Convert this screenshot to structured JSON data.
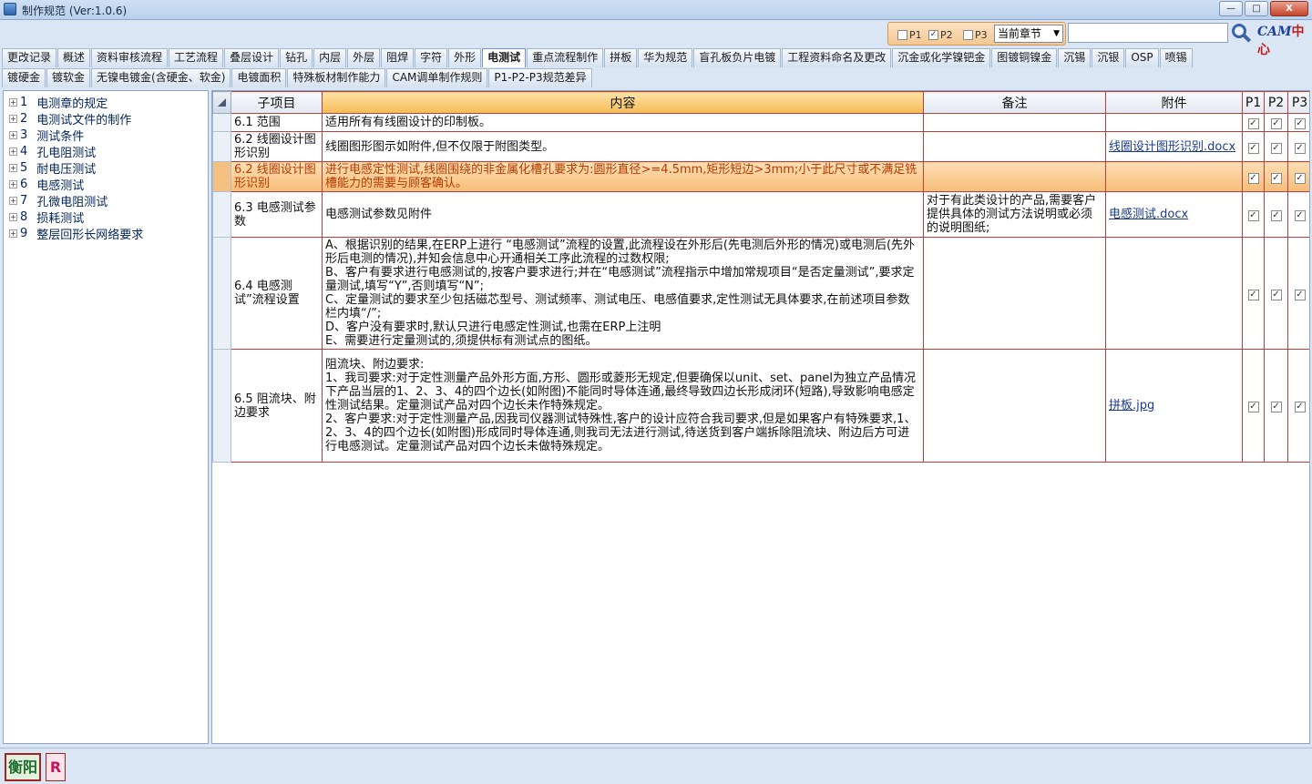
{
  "window": {
    "title": "制作规范 (Ver:1.0.6)",
    "min": "—",
    "max": "□",
    "close": "X"
  },
  "filters": {
    "p1": {
      "label": "P1",
      "checked": false
    },
    "p2": {
      "label": "P2",
      "checked": true
    },
    "p3": {
      "label": "P3",
      "checked": false
    },
    "scope_select": "当前章节",
    "search_value": ""
  },
  "logo": {
    "latin": "CAM",
    "cn": "中心"
  },
  "tabs_row1": [
    "更改记录",
    "概述",
    "资料审核流程",
    "工艺流程",
    "叠层设计",
    "钻孔",
    "内层",
    "外层",
    "阻焊",
    "字符",
    "外形",
    "电测试",
    "重点流程制作",
    "拼板",
    "华为规范",
    "盲孔板负片电镀",
    "工程资料命名及更改",
    "沉金或化学镍钯金",
    "图镀铜镍金",
    "沉锡",
    "沉银",
    "OSP",
    "喷锡"
  ],
  "tabs_row2": [
    "镀硬金",
    "镀软金",
    "无镍电镀金(含硬金、软金)",
    "电镀面积",
    "特殊板材制作能力",
    "CAM调单制作规则",
    "P1-P2-P3规范差异"
  ],
  "active_tab": "电测试",
  "tree": [
    {
      "num": "1",
      "label": "电测章的规定"
    },
    {
      "num": "2",
      "label": "电测试文件的制作"
    },
    {
      "num": "3",
      "label": "测试条件"
    },
    {
      "num": "4",
      "label": "孔电阻测试"
    },
    {
      "num": "5",
      "label": "耐电压测试"
    },
    {
      "num": "6",
      "label": "电感测试"
    },
    {
      "num": "7",
      "label": "孔微电阻测试"
    },
    {
      "num": "8",
      "label": "损耗测试"
    },
    {
      "num": "9",
      "label": "整层回形长网络要求"
    }
  ],
  "grid": {
    "headers": {
      "sub": "子项目",
      "content": "内容",
      "note": "备注",
      "attach": "附件",
      "p1": "P1",
      "p2": "P2",
      "p3": "P3"
    },
    "rows": [
      {
        "sub": "6.1 范围",
        "content": "适用所有有线圈设计的印制板。",
        "note": "",
        "attach": "",
        "p1": true,
        "p2": true,
        "p3": true
      },
      {
        "sub": "6.2 线圈设计图形识别",
        "content": "线圈图形图示如附件,但不仅限于附图类型。",
        "note": "",
        "attach": "线圈设计图形识别.docx",
        "p1": true,
        "p2": true,
        "p3": true
      },
      {
        "sub": "6.2 线圈设计图形识别",
        "content": "进行电感定性测试,线圈围绕的非金属化槽孔要求为:圆形直径>=4.5mm,矩形短边>3mm;小于此尺寸或不满足铣槽能力的需要与顾客确认。",
        "note": "",
        "attach": "",
        "p1": true,
        "p2": true,
        "p3": true
      },
      {
        "sub": "6.3 电感测试参数",
        "content": "电感测试参数见附件",
        "note": "对于有此类设计的产品,需要客户提供具体的测试方法说明或必须的说明图纸;",
        "attach": "电感测试.docx",
        "p1": true,
        "p2": true,
        "p3": true
      },
      {
        "sub": "6.4 电感测试”流程设置",
        "content": "A、根据识别的结果,在ERP上进行 “电感测试”流程的设置,此流程设在外形后(先电测后外形的情况)或电测后(先外形后电测的情况),并知会信息中心开通相关工序此流程的过数权限;\nB、客户有要求进行电感测试的,按客户要求进行;并在“电感测试”流程指示中增加常规项目“是否定量测试”,要求定量测试,填写“Y”,否则填写“N”;\nC、定量测试的要求至少包括磁芯型号、测试频率、测试电压、电感值要求,定性测试无具体要求,在前述项目参数栏内填“/”;\nD、客户没有要求时,默认只进行电感定性测试,也需在ERP上注明\nE、需要进行定量测试的,须提供标有测试点的图纸。",
        "note": "",
        "attach": "",
        "p1": true,
        "p2": true,
        "p3": true
      },
      {
        "sub": "6.5 阻流块、附边要求",
        "content": "阻流块、附边要求:\n1、我司要求:对于定性测量产品外形方面,方形、圆形或菱形无规定,但要确保以unit、set、panel为独立产品情况下产品当层的1、2、3、4的四个边长(如附图)不能同时导体连通,最终导致四边长形成闭环(短路),导致影响电感定性测试结果。定量测试产品对四个边长未作特殊规定。\n2、客户要求:对于定性测量产品,因我司仪器测试特殊性,客户的设计应符合我司要求,但是如果客户有特殊要求,1、2、3、4的四个边长(如附图)形成同时导体连通,则我司无法进行测试,待送货到客户端拆除阻流块、附边后方可进行电感测试。定量测试产品对四个边长未做特殊规定。",
        "note": "",
        "attach": "拼板.jpg",
        "p1": true,
        "p2": true,
        "p3": true
      }
    ]
  },
  "status": {
    "city": "衡阳",
    "badge": "R"
  }
}
